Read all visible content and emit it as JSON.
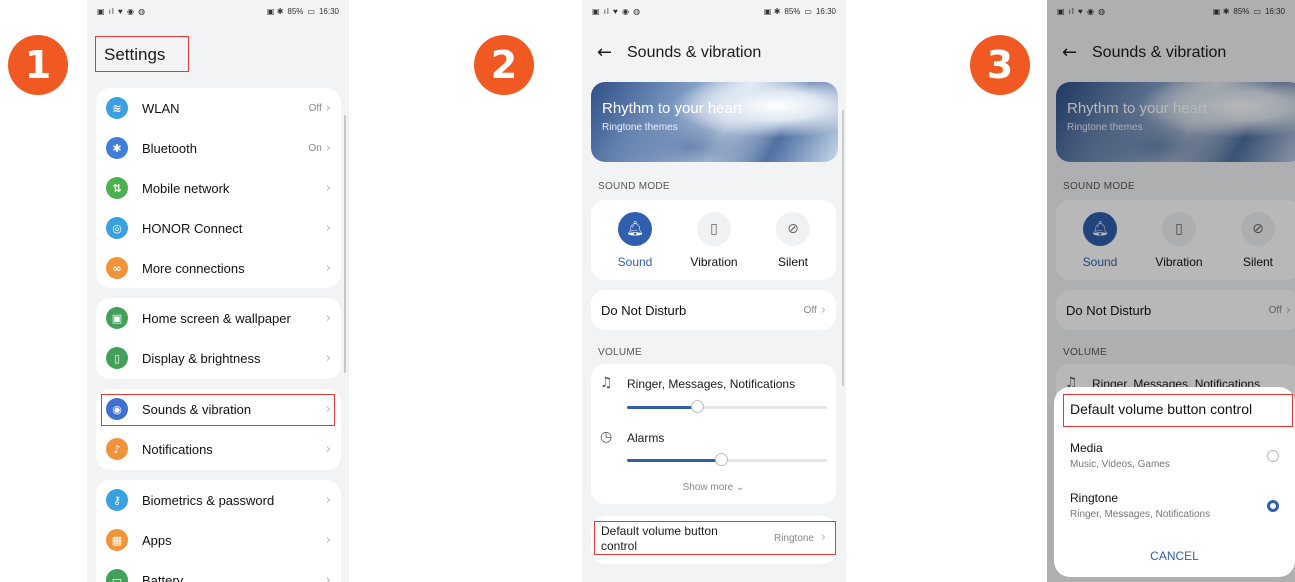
{
  "steps": [
    "1",
    "2",
    "3"
  ],
  "status_bar": {
    "battery": "85%",
    "time": "16:30"
  },
  "colors": {
    "accent": "#2f5fae",
    "badge": "#f05a22",
    "highlight": "#e53935"
  },
  "settings": {
    "title": "Settings",
    "groups": [
      [
        {
          "label": "WLAN",
          "value": "Off",
          "icon": "wifi-icon",
          "color": "#3aa0e0",
          "glyph": "≋"
        },
        {
          "label": "Bluetooth",
          "value": "On",
          "icon": "bluetooth-icon",
          "color": "#3f7fd8",
          "glyph": "✱"
        },
        {
          "label": "Mobile network",
          "value": "",
          "icon": "mobile-network-icon",
          "color": "#4caf50",
          "glyph": "⇅"
        },
        {
          "label": "HONOR Connect",
          "value": "",
          "icon": "honor-connect-icon",
          "color": "#3aa0e0",
          "glyph": "◎"
        },
        {
          "label": "More connections",
          "value": "",
          "icon": "link-icon",
          "color": "#f0943b",
          "glyph": "∞"
        }
      ],
      [
        {
          "label": "Home screen & wallpaper",
          "value": "",
          "icon": "wallpaper-icon",
          "color": "#43a05a",
          "glyph": "▣"
        },
        {
          "label": "Display & brightness",
          "value": "",
          "icon": "display-icon",
          "color": "#43a05a",
          "glyph": "▯"
        }
      ],
      [
        {
          "label": "Sounds & vibration",
          "value": "",
          "icon": "speaker-icon",
          "color": "#3f6fd0",
          "glyph": "◉"
        },
        {
          "label": "Notifications",
          "value": "",
          "icon": "bell-icon",
          "color": "#f0943b",
          "glyph": "♪"
        }
      ],
      [
        {
          "label": "Biometrics & password",
          "value": "",
          "icon": "key-icon",
          "color": "#3aa0e0",
          "glyph": "⚷"
        },
        {
          "label": "Apps",
          "value": "",
          "icon": "apps-icon",
          "color": "#f0943b",
          "glyph": "▦"
        },
        {
          "label": "Battery",
          "value": "",
          "icon": "battery-icon",
          "color": "#43a05a",
          "glyph": "▭"
        }
      ]
    ]
  },
  "sounds": {
    "title": "Sounds & vibration",
    "banner_title": "Rhythm to your heart",
    "banner_subtitle": "Ringtone themes",
    "sound_mode_label": "SOUND MODE",
    "modes": [
      {
        "label": "Sound",
        "active": true,
        "glyph": "🔔"
      },
      {
        "label": "Vibration",
        "active": false,
        "glyph": "▯"
      },
      {
        "label": "Silent",
        "active": false,
        "glyph": "⊘"
      }
    ],
    "dnd_label": "Do Not Disturb",
    "dnd_value": "Off",
    "volume_label": "VOLUME",
    "volumes": [
      {
        "label": "Ringer, Messages, Notifications",
        "level": 0.35
      },
      {
        "label": "Alarms",
        "level": 0.47
      }
    ],
    "show_more": "Show more",
    "default_volume_label": "Default volume button control",
    "default_volume_value": "Ringtone"
  },
  "dialog": {
    "title": "Default volume button control",
    "options": [
      {
        "title": "Media",
        "subtitle": "Music, Videos, Games",
        "selected": false
      },
      {
        "title": "Ringtone",
        "subtitle": "Ringer, Messages, Notifications",
        "selected": true
      }
    ],
    "cancel": "CANCEL"
  }
}
